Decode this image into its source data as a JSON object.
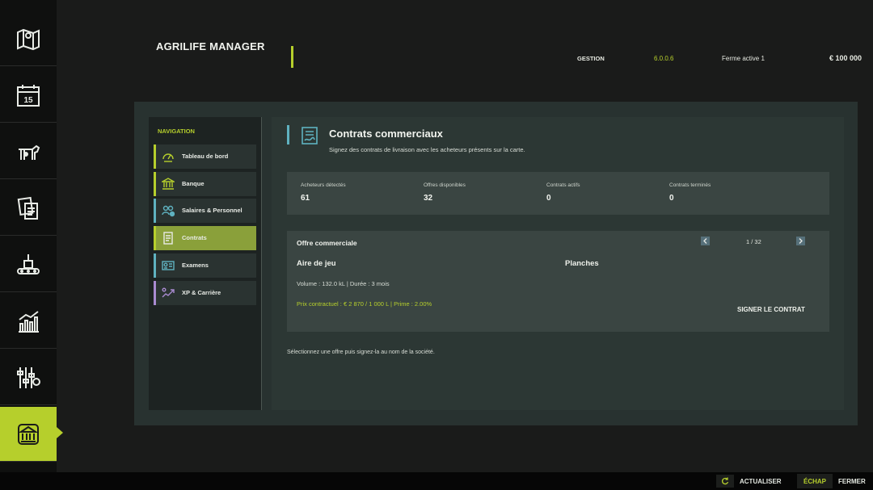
{
  "header": {
    "app_title": "AGRILIFE MANAGER",
    "section": "GESTION",
    "version": "6.0.0.6",
    "farm": "Ferme active 1",
    "money": "€ 100 000"
  },
  "rail": {
    "items": [
      {
        "icon": "map-icon"
      },
      {
        "icon": "calendar-icon",
        "day": "15"
      },
      {
        "icon": "livestock-icon"
      },
      {
        "icon": "documents-icon"
      },
      {
        "icon": "production-icon"
      },
      {
        "icon": "statistics-icon"
      },
      {
        "icon": "settings-sliders-icon"
      },
      {
        "icon": "agrilife-manager-icon",
        "active": true
      }
    ]
  },
  "nav": {
    "heading": "NAVIGATION",
    "items": [
      {
        "label": "Tableau de bord",
        "icon": "dashboard-gauge-icon",
        "color": "#b6cf2c"
      },
      {
        "label": "Banque",
        "icon": "bank-icon",
        "color": "#b6cf2c"
      },
      {
        "label": "Salaires & Personnel",
        "icon": "staff-icon",
        "color": "#5fb2c0"
      },
      {
        "label": "Contrats",
        "icon": "contract-icon",
        "color": "#b6cf2c",
        "active": true
      },
      {
        "label": "Examens",
        "icon": "exam-icon",
        "color": "#5fb2c0"
      },
      {
        "label": "XP & Carrière",
        "icon": "xp-career-icon",
        "color": "#a98bd1"
      }
    ]
  },
  "content": {
    "title": "Contrats commerciaux",
    "subtitle": "Signez des contrats de livraison avec les acheteurs présents sur la carte.",
    "stats": [
      {
        "label": "Acheteurs détectés",
        "value": "61"
      },
      {
        "label": "Offres disponibles",
        "value": "32"
      },
      {
        "label": "Contrats actifs",
        "value": "0"
      },
      {
        "label": "Contrats terminés",
        "value": "0"
      }
    ],
    "offer": {
      "title": "Offre commerciale",
      "pager": "1 / 32",
      "buyer": "Aire de jeu",
      "product": "Planches",
      "volume": "Volume : 132.0 kL  |  Durée : 3 mois",
      "price": "Prix contractuel : € 2 870 / 1 000 L  |  Prime : 2.00%",
      "sign_label": "SIGNER LE CONTRAT"
    },
    "hint": "Sélectionnez une offre puis signez-la au nom de la société."
  },
  "footer": {
    "refresh_label": "ACTUALISER",
    "esc_label": "ÉCHAP",
    "close_label": "FERMER"
  },
  "colors": {
    "accent": "#b6cf2c",
    "teal": "#5fb2c0",
    "purple": "#a98bd1"
  }
}
